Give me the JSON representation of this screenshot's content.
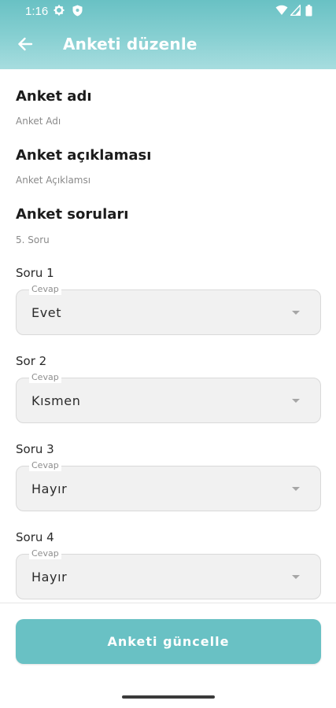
{
  "status_bar": {
    "time": "1:16",
    "icons": [
      "gear-icon",
      "shield-icon",
      "wifi-icon",
      "signal-icon",
      "battery-icon"
    ]
  },
  "app_bar": {
    "back_icon": "arrow-left-icon",
    "title": "Anketi düzenle"
  },
  "survey": {
    "name_heading": "Anket adı",
    "name_value": "Anket Adı",
    "description_heading": "Anket açıklaması",
    "description_value": "Anket Açıklamsı",
    "questions_heading": "Anket soruları",
    "questions_sub": "5. Soru"
  },
  "questions": [
    {
      "label": "Soru 1",
      "field_label": "Cevap",
      "value": "Evet"
    },
    {
      "label": "Sor 2",
      "field_label": "Cevap",
      "value": "Kısmen"
    },
    {
      "label": "Soru 3",
      "field_label": "Cevap",
      "value": "Hayır"
    },
    {
      "label": "Soru 4",
      "field_label": "Cevap",
      "value": "Hayır"
    }
  ],
  "footer": {
    "update_label": "Anketi güncelle"
  },
  "colors": {
    "accent": "#69c1c4",
    "field_bg": "#f1f1f1"
  }
}
